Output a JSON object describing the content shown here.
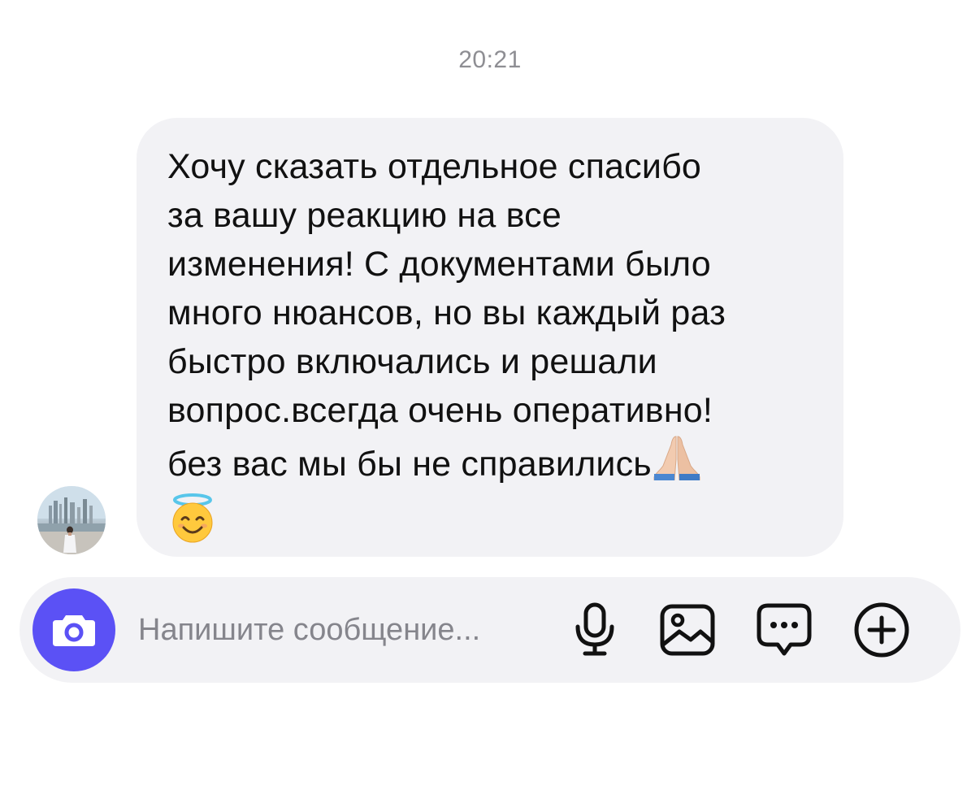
{
  "chat": {
    "timestamp": "20:21",
    "message": {
      "text_lines": [
        "Хочу сказать отдельное спасибо",
        "за вашу реакцию на все",
        "изменения! С документами было",
        "много нюансов, но вы каждый раз",
        "быстро включались и решали",
        "вопрос.всегда очень оперативно!",
        "без вас мы бы не справились"
      ],
      "emojis": [
        "folded-hands",
        "smiling-face-with-halo"
      ]
    },
    "sender": {
      "avatar": "profile-photo"
    }
  },
  "composer": {
    "placeholder": "Напишите сообщение...",
    "value": "",
    "buttons": {
      "camera": "camera-icon",
      "microphone": "microphone-icon",
      "gallery": "image-icon",
      "sticker": "message-dots-icon",
      "more": "plus-circle-icon"
    }
  },
  "colors": {
    "accent": "#5b51f5",
    "bubble_bg": "#f2f2f5",
    "timestamp": "#8e8e93",
    "placeholder": "#85858c",
    "icon": "#111111"
  }
}
